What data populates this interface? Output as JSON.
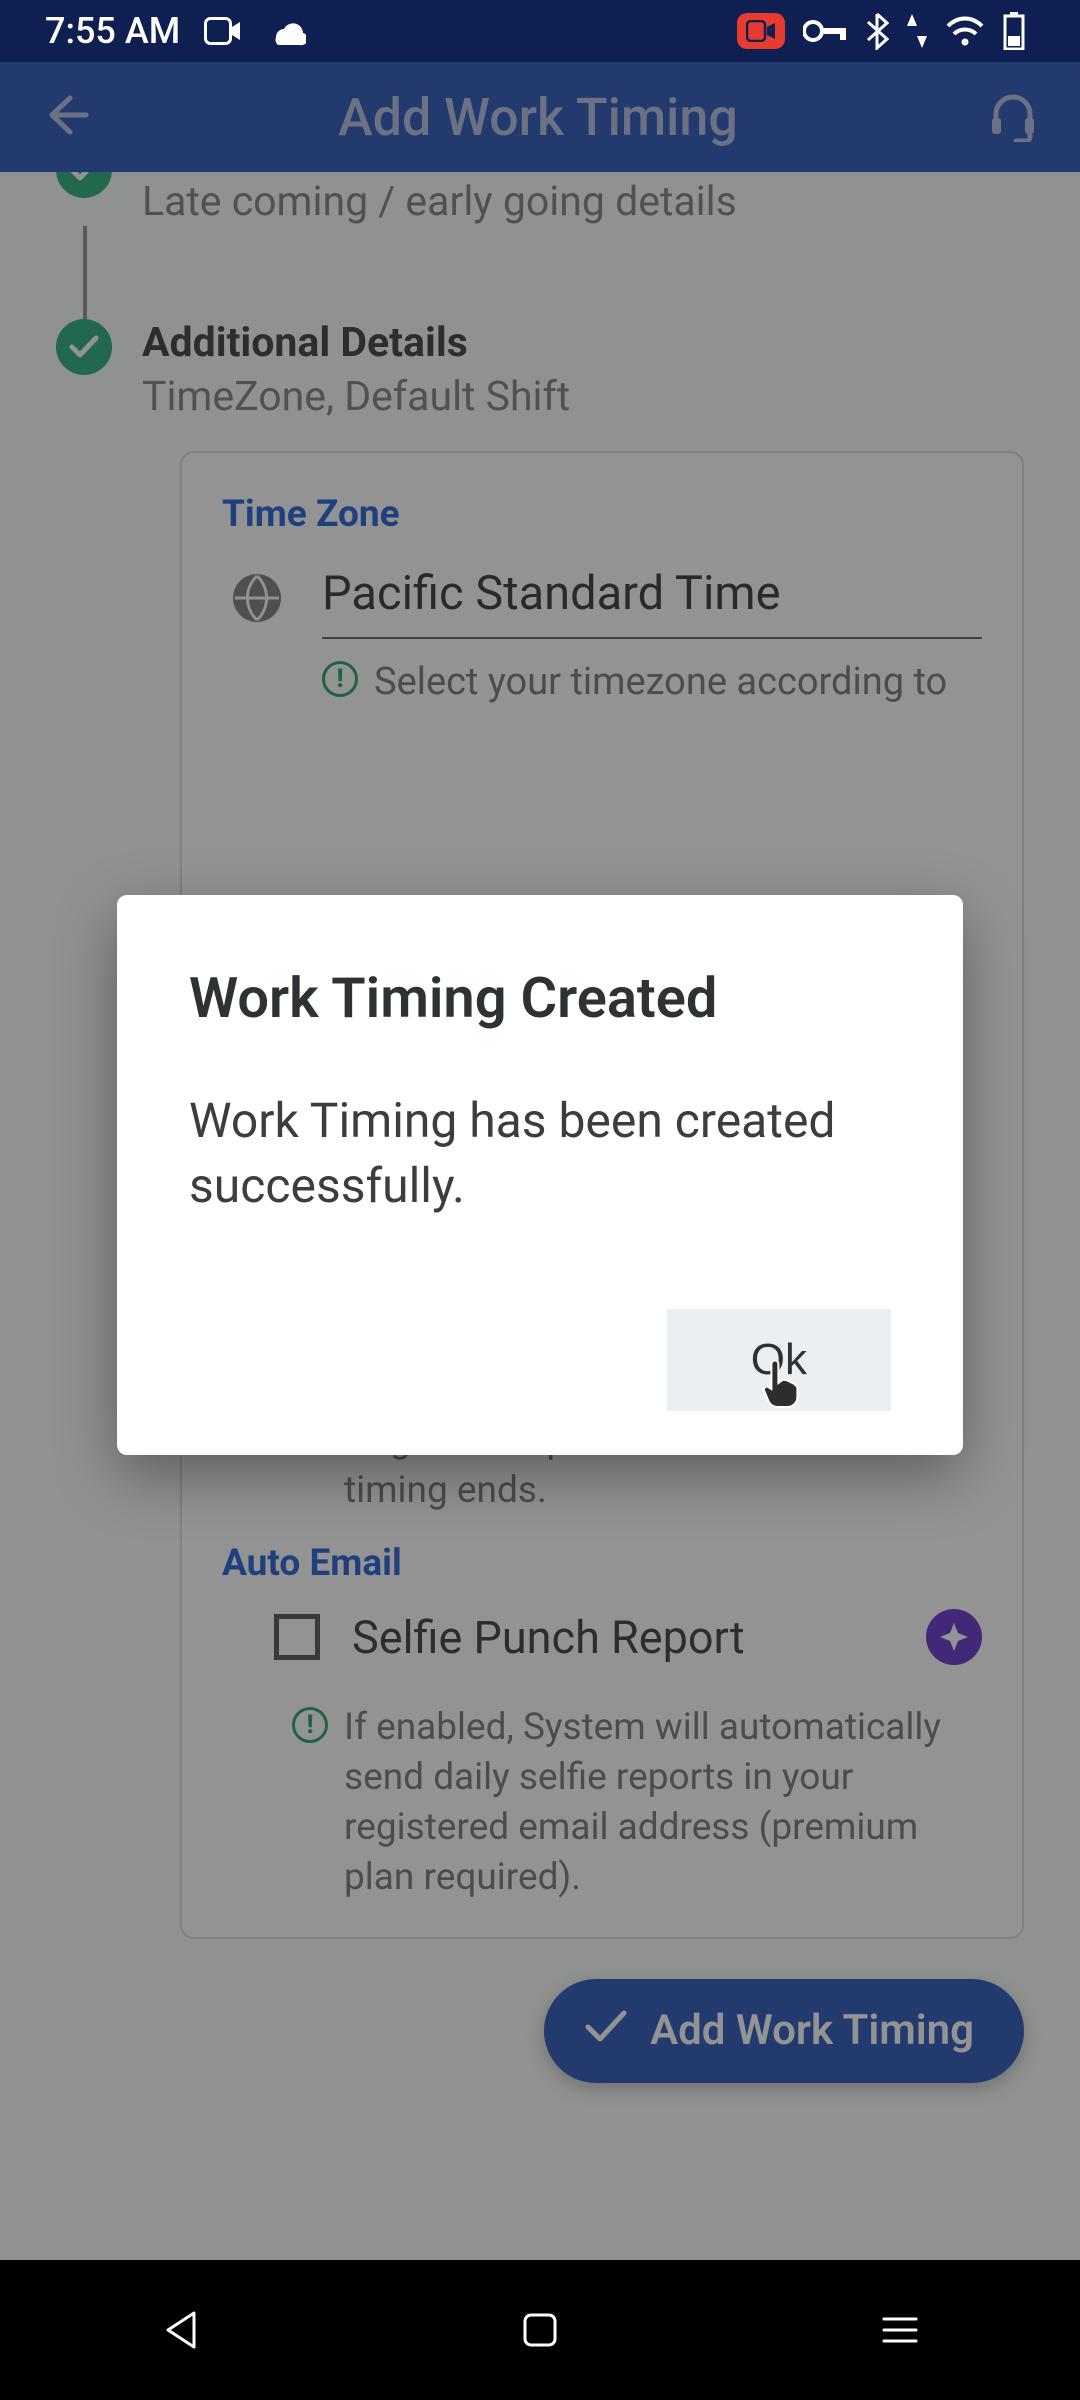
{
  "status_bar": {
    "time": "7:55 AM"
  },
  "app_bar": {
    "title": "Add Work Timing"
  },
  "steps": {
    "step1": {
      "title_cut": "",
      "subtitle": "Late coming / early going details"
    },
    "step2": {
      "title": "Additional Details",
      "subtitle": "TimeZone, Default Shift"
    }
  },
  "card": {
    "tz_label": "Time Zone",
    "tz_value": "Pacific Standard Time",
    "tz_hint": "Select your timezone according to",
    "auto_punch_hint": "If enabled, System will automatically add punch out in case of employee forgot to do punch out after work timing ends.",
    "auto_email_label": "Auto Email",
    "selfie_label": "Selfie Punch Report",
    "selfie_hint": "If enabled, System will automatically send daily selfie reports in your registered email address (premium plan required)."
  },
  "fab": {
    "label": "Add Work Timing"
  },
  "dialog": {
    "title": "Work Timing Created",
    "body": "Work Timing has been created successfully.",
    "ok": "Ok"
  }
}
